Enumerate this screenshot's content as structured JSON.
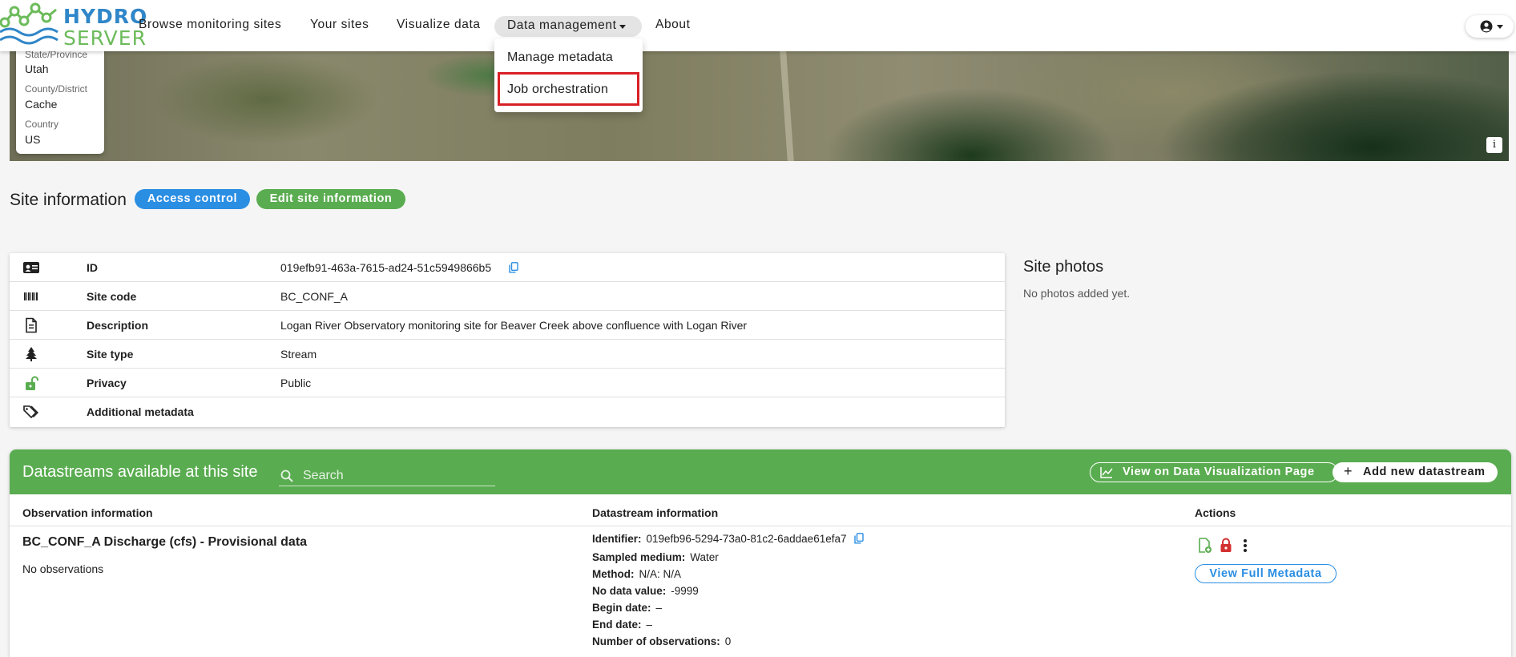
{
  "app": {
    "logo_top": "HYDRO",
    "logo_bottom": "SERVER",
    "colors": {
      "brand_green": "#5aac50",
      "brand_blue": "#2a8ee3",
      "highlight_red": "#d92027"
    }
  },
  "nav": {
    "browse": "Browse monitoring sites",
    "your_sites": "Your sites",
    "visualize": "Visualize data",
    "data_management": "Data management",
    "about": "About",
    "account_icon": "account-circle-icon"
  },
  "dropdown": {
    "items": [
      "Manage metadata",
      "Job orchestration"
    ]
  },
  "location": {
    "state_label": "State/Province",
    "state_value": "Utah",
    "county_label": "County/District",
    "county_value": "Cache",
    "country_label": "Country",
    "country_value": "US",
    "info_glyph": "i"
  },
  "site": {
    "title": "Site information",
    "access_control": "Access control",
    "edit": "Edit site information",
    "rows": [
      {
        "icon": "id-card-icon",
        "label": "ID",
        "value": "019efb91-463a-7615-ad24-51c5949866b5"
      },
      {
        "icon": "barcode-icon",
        "label": "Site code",
        "value": "BC_CONF_A"
      },
      {
        "icon": "document-icon",
        "label": "Description",
        "value": "Logan River Observatory monitoring site for Beaver Creek above confluence with Logan River"
      },
      {
        "icon": "tree-icon",
        "label": "Site type",
        "value": "Stream"
      },
      {
        "icon": "unlock-icon",
        "label": "Privacy",
        "value": "Public"
      },
      {
        "icon": "tags-icon",
        "label": "Additional metadata",
        "value": ""
      }
    ]
  },
  "photos": {
    "title": "Site photos",
    "empty": "No photos added yet."
  },
  "datastreams": {
    "title": "Datastreams available at this site",
    "search_placeholder": "Search",
    "view_viz": "View on Data Visualization Page",
    "add_new": "Add new datastream",
    "columns": [
      "Observation information",
      "Datastream information",
      "Actions"
    ],
    "items": [
      {
        "name": "BC_CONF_A Discharge (cfs) - Provisional data",
        "observations": "No observations",
        "meta": [
          {
            "label": "Identifier:",
            "value": "019efb96-5294-73a0-81c2-6addae61efa7"
          },
          {
            "label": "Sampled medium:",
            "value": "Water"
          },
          {
            "label": "Method:",
            "value": "N/A: N/A"
          },
          {
            "label": "No data value:",
            "value": "-9999"
          },
          {
            "label": "Begin date:",
            "value": "–"
          },
          {
            "label": "End date:",
            "value": "–"
          },
          {
            "label": "Number of observations:",
            "value": "0"
          }
        ],
        "view_full": "View Full Metadata"
      }
    ]
  }
}
